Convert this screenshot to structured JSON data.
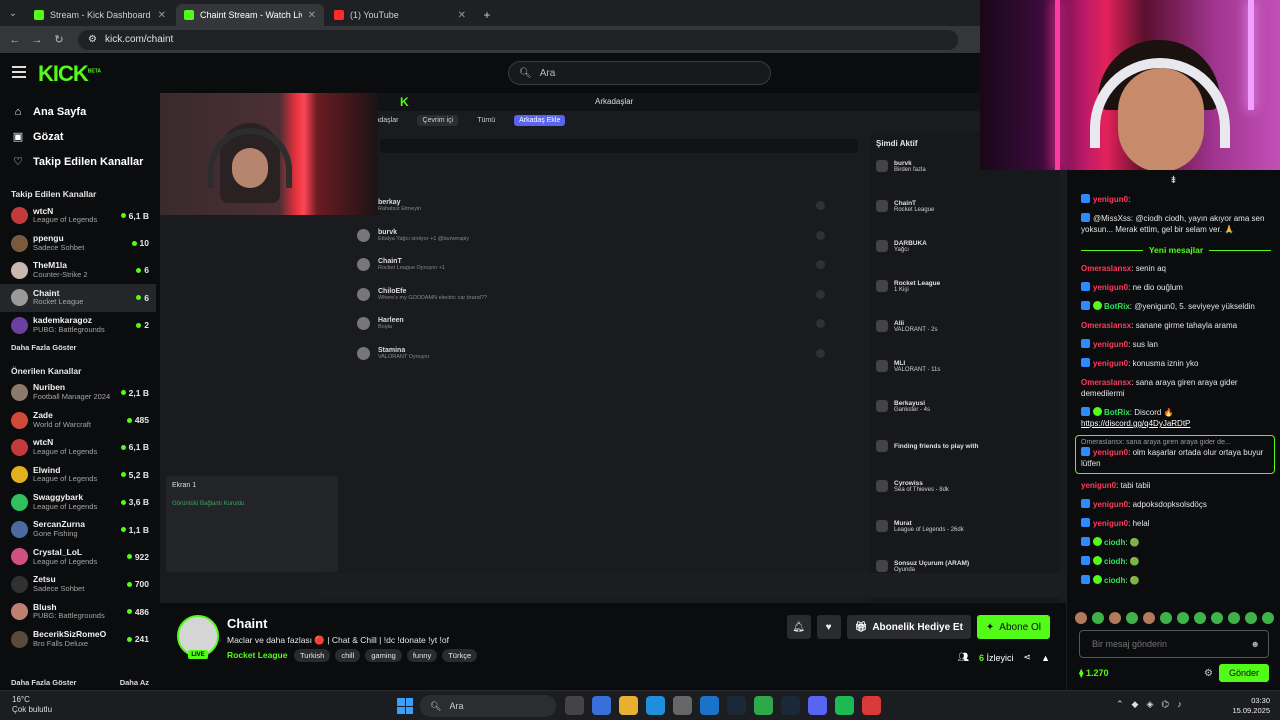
{
  "browser": {
    "tabs": [
      {
        "title": "Stream - Kick Dashboard",
        "active": false
      },
      {
        "title": "Chaint Stream - Watch Live on Kick",
        "active": true
      },
      {
        "title": "(1) YouTube",
        "active": false
      }
    ],
    "url": "kick.com/chaint"
  },
  "header": {
    "logo": "KICK",
    "logo_beta": "BETA",
    "search_placeholder": "Ara"
  },
  "sidebar": {
    "nav": [
      {
        "label": "Ana Sayfa",
        "icon": "home-icon"
      },
      {
        "label": "Gözat",
        "icon": "browse-icon"
      },
      {
        "label": "Takip Edilen Kanallar",
        "icon": "heart-icon"
      }
    ],
    "followed_heading": "Takip Edilen Kanallar",
    "followed": [
      {
        "name": "wtcN",
        "category": "League of Legends",
        "viewers": "6,1 B",
        "color": "#c23a3a"
      },
      {
        "name": "ppengu",
        "category": "Sadece Sohbet",
        "viewers": "10",
        "color": "#7a5a3a"
      },
      {
        "name": "TheM1la",
        "category": "Counter-Strike 2",
        "viewers": "6",
        "color": "#c8b8b0"
      },
      {
        "name": "Chaint",
        "category": "Rocket League",
        "viewers": "6",
        "color": "#9a9a9a"
      },
      {
        "name": "kademkaragoz",
        "category": "PUBG: Battlegrounds",
        "viewers": "2",
        "color": "#6b3fa0"
      }
    ],
    "followed_more": "Daha Fazla Göster",
    "recommended_heading": "Önerilen Kanallar",
    "recommended": [
      {
        "name": "Nuriben",
        "category": "Football Manager 2024",
        "viewers": "2,1 B",
        "color": "#8a7a6a"
      },
      {
        "name": "Zade",
        "category": "World of Warcraft",
        "viewers": "485",
        "color": "#d04a3a"
      },
      {
        "name": "wtcN",
        "category": "League of Legends",
        "viewers": "6,1 B",
        "color": "#c23a3a"
      },
      {
        "name": "Elwind",
        "category": "League of Legends",
        "viewers": "5,2 B",
        "color": "#e0b020"
      },
      {
        "name": "Swaggybark",
        "category": "League of Legends",
        "viewers": "3,6 B",
        "color": "#30c060"
      },
      {
        "name": "SercanZurna",
        "category": "Gone Fishing",
        "viewers": "1,1 B",
        "color": "#4a6aa0"
      },
      {
        "name": "Crystal_LoL",
        "category": "League of Legends",
        "viewers": "922",
        "color": "#d05080"
      },
      {
        "name": "Zetsu",
        "category": "Sadece Sohbet",
        "viewers": "700",
        "color": "#303030"
      },
      {
        "name": "Blush",
        "category": "PUBG: Battlegrounds",
        "viewers": "486",
        "color": "#c08070"
      },
      {
        "name": "BecerikSizRomeO",
        "category": "Bro Falls Deluxe",
        "viewers": "241",
        "color": "#5a4a3a"
      }
    ],
    "recommended_more": "Daha Fazla Göster",
    "less": "Daha Az"
  },
  "stream_overlay": {
    "discord_tabs": [
      "Arkadaşlar",
      "Çevrim içi",
      "Tümü",
      "Arkadaş Ekle"
    ],
    "discord_friends": [
      {
        "name": "berkay",
        "sub": "Rahatsız Etmeyin"
      },
      {
        "name": "burvk",
        "sub": "Ettalya Yağcı sinliyor +1 @burverapiy"
      },
      {
        "name": "ChainT",
        "sub": "Rocket League Oynuyor +1"
      },
      {
        "name": "ChiloEfe",
        "sub": "Where's my GODDAMN electric car brand??"
      },
      {
        "name": "Harleen",
        "sub": "Boşta"
      },
      {
        "name": "Stamina",
        "sub": "VALORANT Oynuyor"
      }
    ],
    "active_now_title": "Şimdi Aktif",
    "active_now": [
      {
        "name": "burvk",
        "sub": "Birden fazla"
      },
      {
        "name": "ChainT",
        "sub": "Rocket League"
      },
      {
        "name": "DARBUKA",
        "sub": "Yağcı"
      },
      {
        "name": "Rocket League",
        "sub": "1 Kişi"
      },
      {
        "name": "Alii",
        "sub": "VALORANT - 2s"
      },
      {
        "name": "MLI",
        "sub": "VALORANT - 11s"
      },
      {
        "name": "Berkayusi",
        "sub": "Gankster - 4s"
      },
      {
        "name": "Finding friends to play with",
        "sub": ""
      },
      {
        "name": "Cyrowiss",
        "sub": "Sea of Thieves - 8dk"
      },
      {
        "name": "Murat",
        "sub": "League of Legends - 26dk"
      },
      {
        "name": "Sonsuz Uçurum (ARAM)",
        "sub": "Oyunda"
      }
    ],
    "screen_label": "Ekran 1",
    "voice_status": "Görüntülü Bağlantı Kuruldu"
  },
  "chat": {
    "messages": [
      {
        "type": "msg",
        "badge": "blue",
        "user": "yenigun0",
        "color": "red",
        "text": ""
      },
      {
        "type": "msg",
        "badge": "blue",
        "user": "",
        "color": "red",
        "text": "@MissXss: @ciodh ciodh, yayın akıyor ama sen yoksun... Merak ettim, gel bir selam ver. 🙏"
      },
      {
        "type": "divider",
        "text": "Yeni mesajlar"
      },
      {
        "type": "msg",
        "badge": "",
        "user": "Omeraslansx",
        "color": "red",
        "text": "senin aq"
      },
      {
        "type": "msg",
        "badge": "blue",
        "user": "yenigun0",
        "color": "red",
        "text": "ne dio ouğlum"
      },
      {
        "type": "msg",
        "badge": "bot",
        "user": "BotRix",
        "color": "green",
        "text": "@yenigun0, 5. seviyeye yükseldin"
      },
      {
        "type": "msg",
        "badge": "",
        "user": "Omeraslansx",
        "color": "red",
        "text": "sanane girme tahayla arama"
      },
      {
        "type": "msg",
        "badge": "blue",
        "user": "yenigun0",
        "color": "red",
        "text": "sus lan"
      },
      {
        "type": "msg",
        "badge": "blue",
        "user": "yenigun0",
        "color": "red",
        "text": "konusma iznin yko"
      },
      {
        "type": "msg",
        "badge": "",
        "user": "Omeraslansx",
        "color": "red",
        "text": "sana araya giren araya gider demedilermi"
      },
      {
        "type": "msg",
        "badge": "bot",
        "user": "BotRix",
        "color": "green",
        "text": "Discord 🔥",
        "link": "https://discord.gg/q4DyJaRDtP"
      },
      {
        "type": "reply",
        "quote": "Omeraslansx: sana araya giren araya gider de...",
        "badge": "blue",
        "user": "yenigun0",
        "color": "red",
        "text": "olm kaşarlar ortada olur ortaya buyur lütfen"
      },
      {
        "type": "msg",
        "badge": "",
        "user": "yenigun0",
        "color": "red",
        "text": "tabi tabii"
      },
      {
        "type": "msg",
        "badge": "blue",
        "user": "yenigun0",
        "color": "red",
        "text": "adpoksdopksolsdöçs"
      },
      {
        "type": "msg",
        "badge": "blue",
        "user": "yenigun0",
        "color": "red",
        "text": "helal"
      },
      {
        "type": "msg",
        "badge": "sub",
        "user": "ciodh",
        "color": "green",
        "text": "🟢"
      },
      {
        "type": "msg",
        "badge": "sub",
        "user": "ciodh",
        "color": "green",
        "text": "🟢"
      },
      {
        "type": "msg",
        "badge": "sub",
        "user": "ciodh",
        "color": "green",
        "text": "🟢"
      }
    ],
    "input_placeholder": "Bir mesaj gönderin",
    "points": "1.270",
    "send_label": "Gönder"
  },
  "channel": {
    "name": "Chaint",
    "live": "LIVE",
    "title": "Maclar ve daha fazlası 🔴 | Chat & Chill | !dc  !donate  !yt  !of",
    "category": "Rocket League",
    "tags": [
      "Turkish",
      "chill",
      "gaming",
      "funny",
      "Türkçe"
    ],
    "gift_label": "Abonelik Hediye Et",
    "subscribe_label": "Abone Ol",
    "viewers_count": "6",
    "viewers_label": "İzleyici"
  },
  "taskbar": {
    "weather_temp": "16°C",
    "weather_desc": "Çok bulutlu",
    "search_placeholder": "Ara",
    "time": "03:30",
    "date": "15.09.2025"
  },
  "colors": {
    "kick_green": "#53fc18",
    "background": "#0b0c0e",
    "username_red": "#ff3b5f"
  }
}
